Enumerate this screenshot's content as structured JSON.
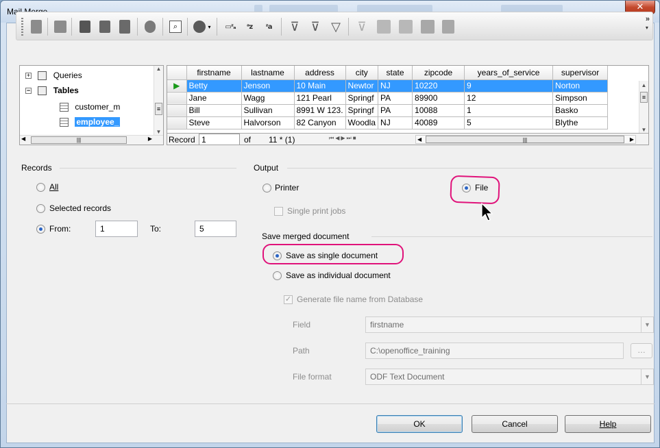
{
  "window": {
    "title": "Mail Merge"
  },
  "tree": {
    "items": [
      {
        "label": "Queries",
        "toggle": "+"
      },
      {
        "label": "Tables",
        "toggle": "−"
      },
      {
        "label": "customer_m"
      },
      {
        "label": "employee_"
      }
    ]
  },
  "grid": {
    "columns": [
      "firstname",
      "lastname",
      "address",
      "city",
      "state",
      "zipcode",
      "years_of_service",
      "supervisor"
    ],
    "rows": [
      [
        "Betty",
        "Jenson",
        "10 Main",
        "Newtor",
        "NJ",
        "10220",
        "9",
        "Norton"
      ],
      [
        "Jane",
        "Wagg",
        "121 Pearl",
        "Springf",
        "PA",
        "89900",
        "12",
        "Simpson"
      ],
      [
        "Bill",
        "Sullivan",
        "8991 W 123.",
        "Springf",
        "PA",
        "10088",
        "1",
        "Basko"
      ],
      [
        "Steve",
        "Halvorson",
        "82 Canyon",
        "Woodla",
        "NJ",
        "40089",
        "5",
        "Blythe"
      ]
    ],
    "nav": {
      "record_label": "Record",
      "record_value": "1",
      "of_label": "of",
      "count": "11 * (1)"
    }
  },
  "records": {
    "heading": "Records",
    "all": "All",
    "selected": "Selected records",
    "from_label": "From:",
    "from_value": "1",
    "to_label": "To:",
    "to_value": "5"
  },
  "output": {
    "heading": "Output",
    "printer": "Printer",
    "file": "File",
    "single_print_jobs": "Single print jobs"
  },
  "save": {
    "heading": "Save merged document",
    "single": "Save as single document",
    "individual": "Save as individual document",
    "generate": "Generate file name from Database",
    "field_label": "Field",
    "field_value": "firstname",
    "path_label": "Path",
    "path_value": "C:\\openoffice_training",
    "format_label": "File format",
    "format_value": "ODF Text Document"
  },
  "buttons": {
    "ok": "OK",
    "cancel": "Cancel",
    "help": "Help"
  },
  "colors": {
    "highlight": "#e0127a",
    "selection": "#3399ff",
    "accent": "#2a64c5"
  }
}
